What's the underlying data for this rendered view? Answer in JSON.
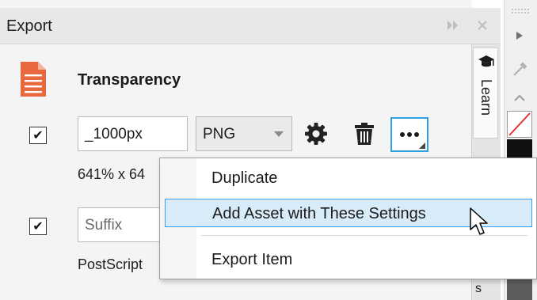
{
  "panel": {
    "title": "Export",
    "icons": {
      "expand": "double-chevron-right-icon",
      "close": "close-icon"
    }
  },
  "document": {
    "name": "Transparency",
    "icon": "document-icon",
    "icon_color": "#e8693e"
  },
  "row1": {
    "checked": "✔",
    "suffix_value": "_1000px",
    "format": "PNG",
    "size_text": "641% x 64",
    "tools": [
      "gear-icon",
      "trash-icon",
      "more-icon"
    ]
  },
  "row2": {
    "checked": "✔",
    "suffix_placeholder": "Suffix",
    "format_text": "PostScript"
  },
  "side_tabs": {
    "learn": "Learn",
    "bottom_tab": "s"
  },
  "context_menu": {
    "items": [
      {
        "label": "Duplicate"
      },
      {
        "label": "Add Asset with These Settings"
      },
      {
        "label": "Export Item"
      }
    ]
  },
  "colors": {
    "accent": "#2f9fe0",
    "highlight": "#d8ebf9"
  }
}
